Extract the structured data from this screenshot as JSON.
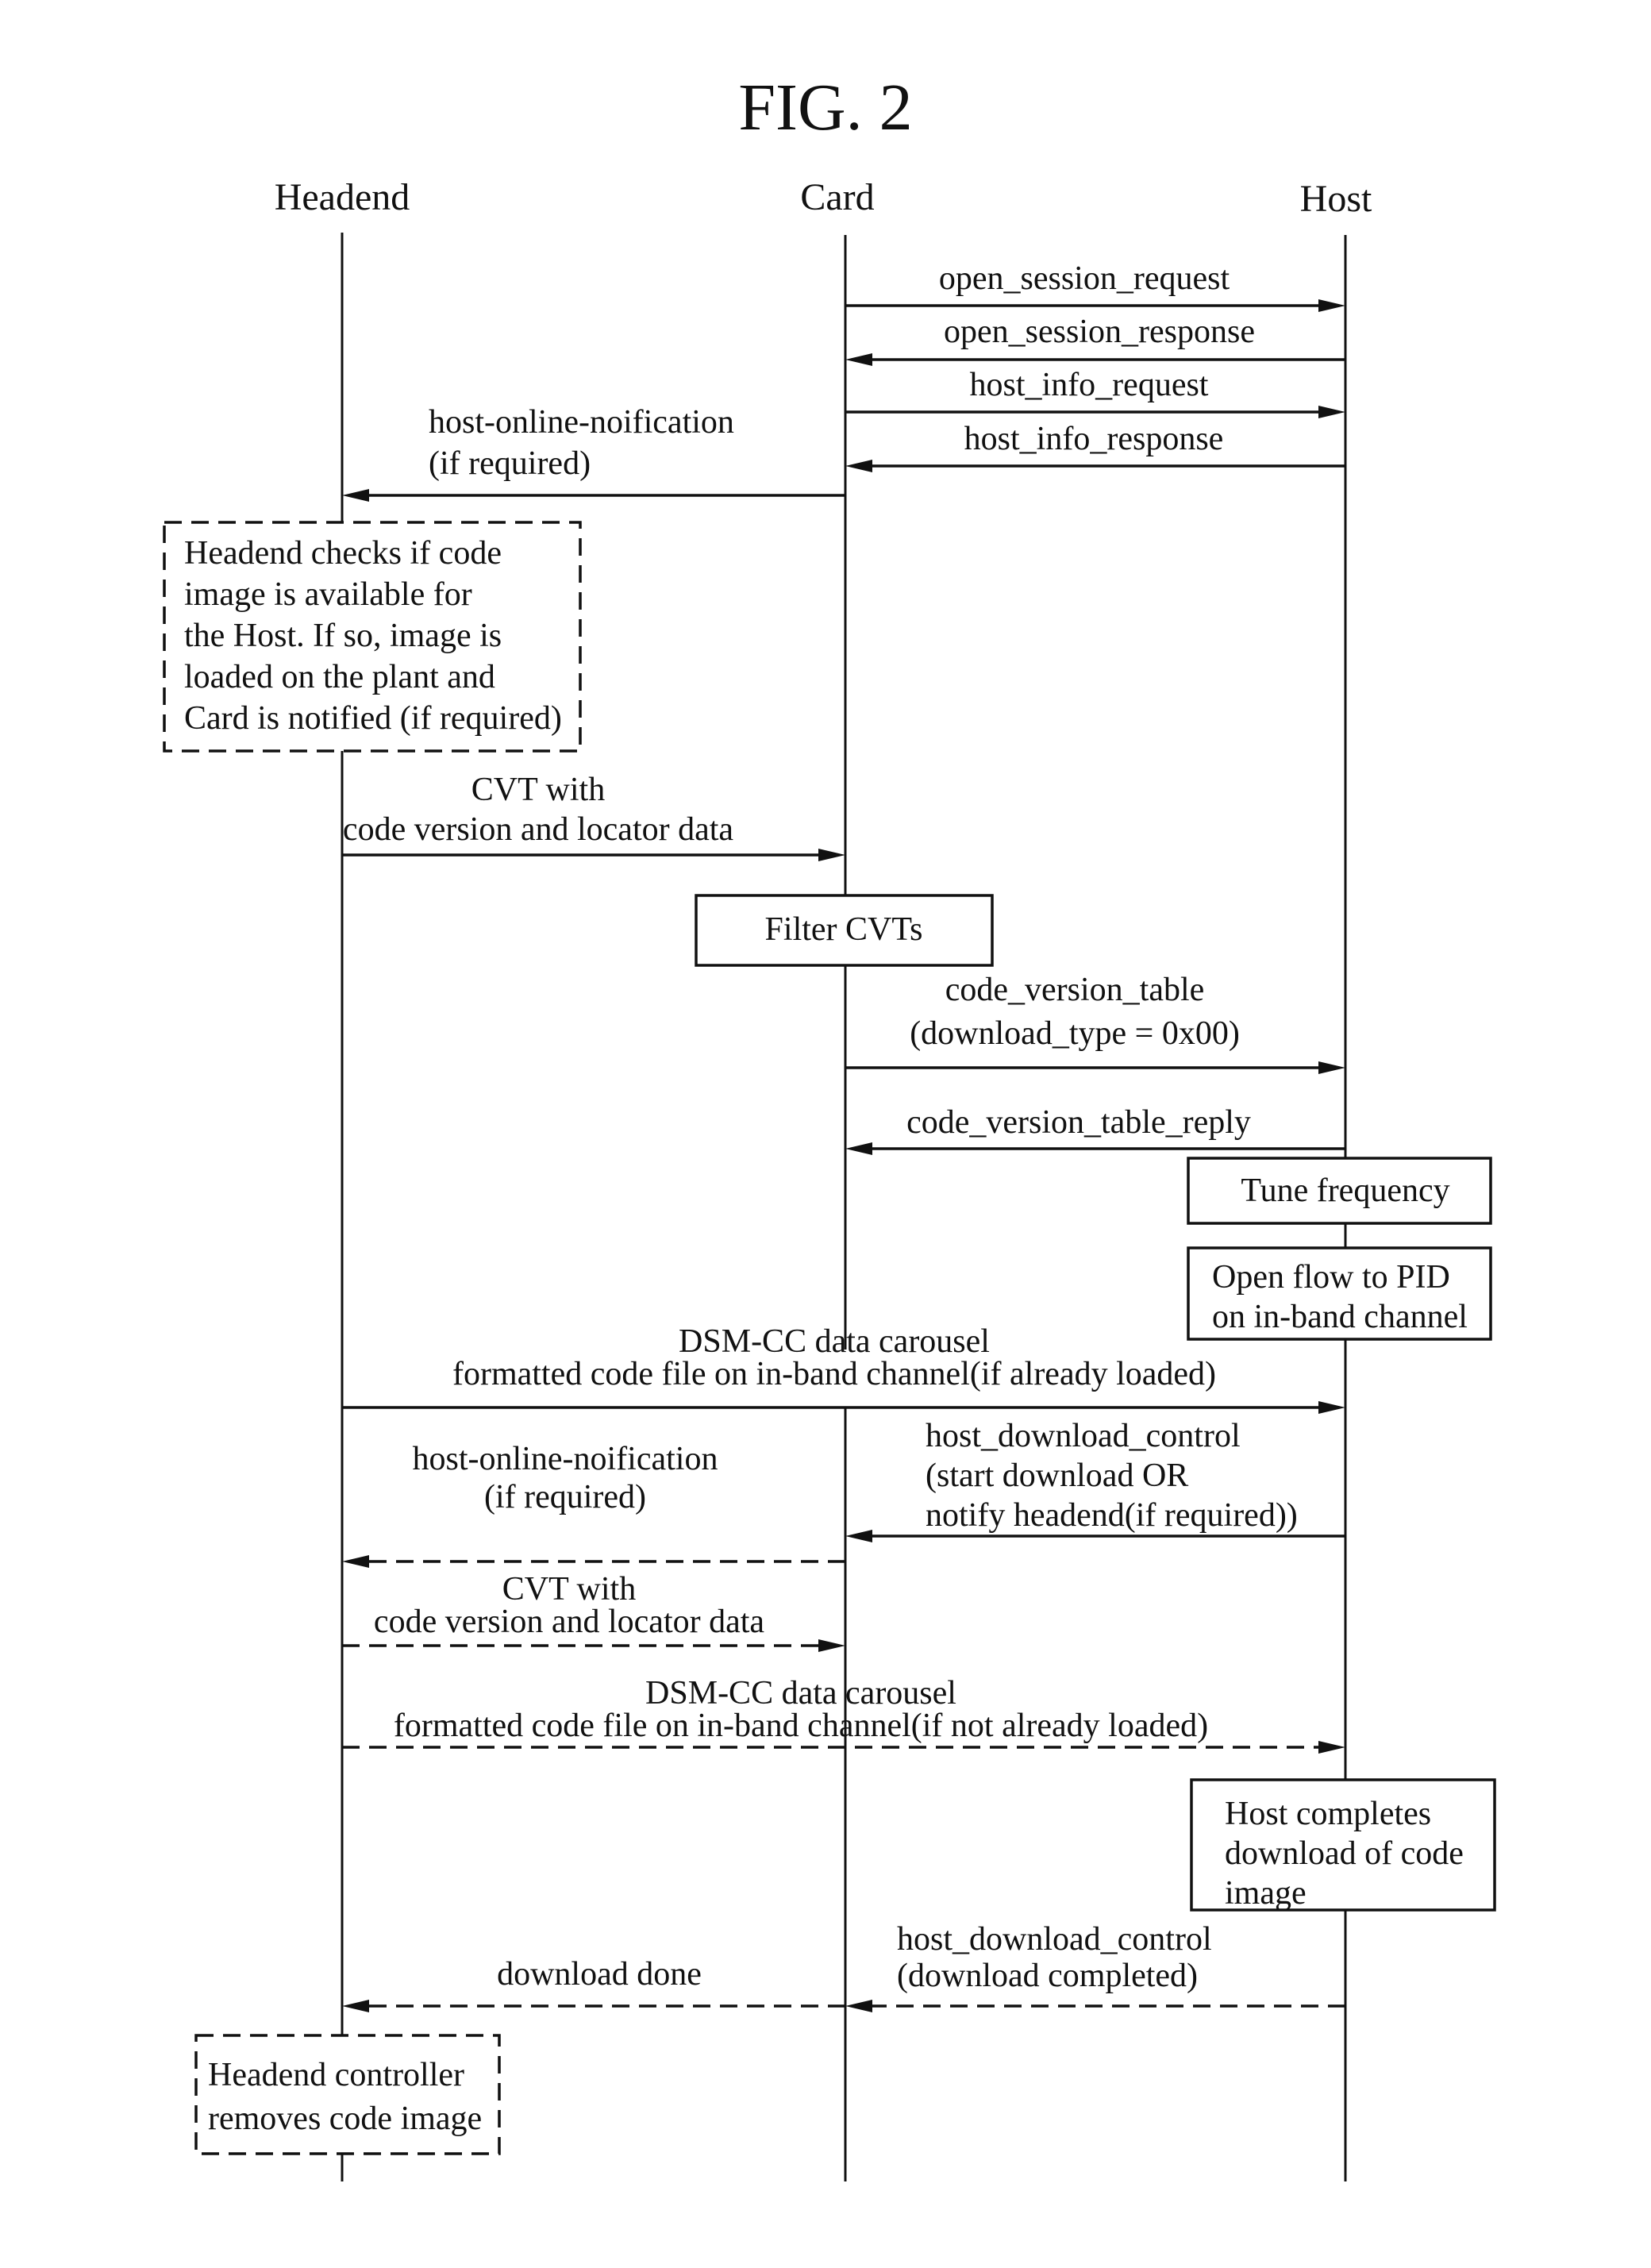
{
  "figure": {
    "title": "FIG. 2",
    "actors": [
      "Headend",
      "Card",
      "Host"
    ]
  },
  "messages": [
    {
      "id": "open-session-request",
      "from": "Card",
      "to": "Host",
      "style": "solid",
      "lines": [
        "open_session_request"
      ]
    },
    {
      "id": "open-session-response",
      "from": "Host",
      "to": "Card",
      "style": "solid",
      "lines": [
        "open_session_response"
      ]
    },
    {
      "id": "host-info-request",
      "from": "Card",
      "to": "Host",
      "style": "solid",
      "lines": [
        "host_info_request"
      ]
    },
    {
      "id": "host-info-response",
      "from": "Host",
      "to": "Card",
      "style": "solid",
      "lines": [
        "host_info_response"
      ]
    },
    {
      "id": "host-online-notification-1",
      "from": "Card",
      "to": "Headend",
      "style": "solid",
      "lines": [
        "host-online-noification",
        "(if required)"
      ]
    },
    {
      "id": "cvt-1",
      "from": "Headend",
      "to": "Card",
      "style": "solid",
      "lines": [
        "CVT with",
        "code version and locator data"
      ]
    },
    {
      "id": "code-version-table",
      "from": "Card",
      "to": "Host",
      "style": "solid",
      "lines": [
        "code_version_table",
        "(download_type = 0x00)"
      ]
    },
    {
      "id": "code-version-table-reply",
      "from": "Host",
      "to": "Card",
      "style": "solid",
      "lines": [
        "code_version_table_reply"
      ]
    },
    {
      "id": "dsmcc-1",
      "from": "Headend",
      "to": "Host",
      "style": "solid",
      "lines": [
        "DSM-CC data carousel",
        "formatted code file on in-band channel(if already loaded)"
      ]
    },
    {
      "id": "host-download-control-1",
      "from": "Host",
      "to": "Card",
      "style": "solid",
      "lines": [
        "host_download_control",
        "(start download OR",
        "notify headend(if required))"
      ]
    },
    {
      "id": "host-online-notification-2",
      "from": "Card",
      "to": "Headend",
      "style": "dashed",
      "lines": [
        "host-online-noification",
        "(if required)"
      ]
    },
    {
      "id": "cvt-2",
      "from": "Headend",
      "to": "Card",
      "style": "dashed",
      "lines": [
        "CVT with",
        "code version and locator data"
      ]
    },
    {
      "id": "dsmcc-2",
      "from": "Headend",
      "to": "Host",
      "style": "dashed",
      "lines": [
        "DSM-CC data carousel",
        "formatted code file on in-band channel(if not already loaded)"
      ]
    },
    {
      "id": "host-download-control-2",
      "from": "Host",
      "to": "Card",
      "style": "dashed",
      "lines": [
        "host_download_control",
        "(download completed)"
      ]
    },
    {
      "id": "download-done",
      "from": "Card",
      "to": "Headend",
      "style": "dashed",
      "lines": [
        "download done"
      ]
    }
  ],
  "notes": [
    {
      "id": "headend-checks",
      "actor": "Headend",
      "style": "dashed",
      "lines": [
        "Headend checks if code",
        "image is available for",
        "the Host. If so, image is",
        "loaded on the plant and",
        "Card is notified (if required)"
      ]
    },
    {
      "id": "filter-cvts",
      "actor": "Card",
      "style": "solid",
      "lines": [
        "Filter CVTs"
      ]
    },
    {
      "id": "tune-frequency",
      "actor": "Host",
      "style": "solid",
      "lines": [
        "Tune frequency"
      ]
    },
    {
      "id": "open-flow",
      "actor": "Host",
      "style": "solid",
      "lines": [
        "Open flow to PID",
        "on in-band channel"
      ]
    },
    {
      "id": "host-completes",
      "actor": "Host",
      "style": "solid",
      "lines": [
        "Host completes",
        "download of code",
        "image"
      ]
    },
    {
      "id": "headend-removes",
      "actor": "Headend",
      "style": "dashed",
      "lines": [
        "Headend controller",
        "removes code image"
      ]
    }
  ]
}
